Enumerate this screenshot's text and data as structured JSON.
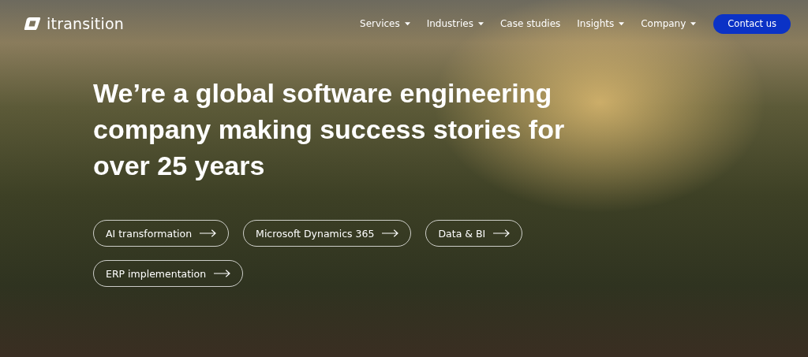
{
  "header": {
    "logo_text": "itransition",
    "nav": [
      {
        "label": "Services",
        "has_menu": true
      },
      {
        "label": "Industries",
        "has_menu": true
      },
      {
        "label": "Case studies",
        "has_menu": false
      },
      {
        "label": "Insights",
        "has_menu": true
      },
      {
        "label": "Company",
        "has_menu": true
      }
    ],
    "cta": "Contact us"
  },
  "hero": {
    "headline": "We’re a global software engineering company making success stories for over 25 years",
    "links": [
      {
        "label": "AI transformation"
      },
      {
        "label": "Microsoft Dynamics 365"
      },
      {
        "label": "Data & BI"
      },
      {
        "label": "ERP implementation"
      }
    ]
  }
}
